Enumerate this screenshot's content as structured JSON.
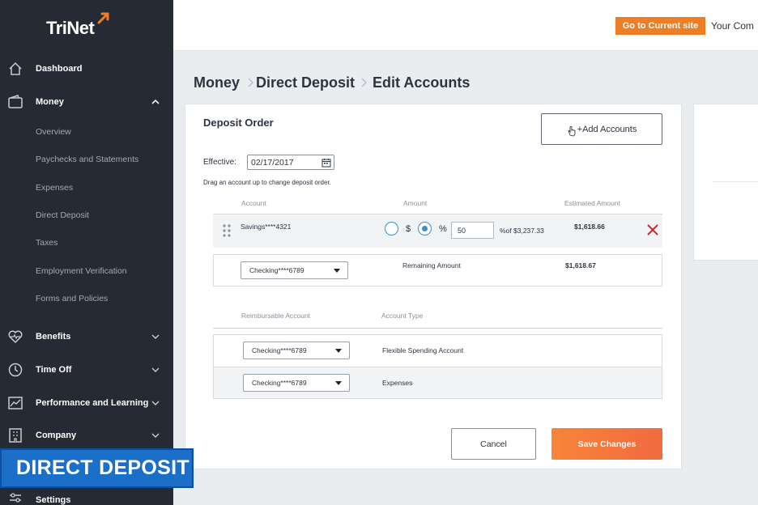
{
  "brand": {
    "logo": "TriNet"
  },
  "topbar": {
    "goto_label": "Go to Current site",
    "company_label": "Your Com"
  },
  "sidebar": {
    "items": [
      {
        "label": "Dashboard",
        "icon": "home-icon"
      },
      {
        "label": "Money",
        "icon": "wallet-icon",
        "expanded": true
      },
      {
        "label": "Benefits",
        "icon": "heart-pulse-icon"
      },
      {
        "label": "Time Off",
        "icon": "clock-icon"
      },
      {
        "label": "Performance and Learning",
        "icon": "chart-icon"
      },
      {
        "label": "Company",
        "icon": "company-icon"
      },
      {
        "label": "Settings",
        "icon": "settings-icon"
      }
    ],
    "money_sub": [
      "Overview",
      "Paychecks and Statements",
      "Expenses",
      "Direct Deposit",
      "Taxes",
      "Employment Verification",
      "Forms and Policies"
    ]
  },
  "breadcrumb": [
    "Money",
    "Direct Deposit",
    "Edit Accounts"
  ],
  "deposit": {
    "title": "Deposit Order",
    "add_accounts": "+Add Accounts",
    "effective_label": "Effective:",
    "effective_date": "02/17/2017",
    "drag_hint": "Drag an account up to change deposit order.",
    "headers": {
      "account": "Account",
      "amount": "Amount",
      "estimated": "Estimated Amount"
    },
    "savings": {
      "account": "Savings****4321",
      "dollar": "$",
      "percent": "%",
      "value": "50",
      "of_total": "%of $3,237.33",
      "estimated": "$1,618.66",
      "selected_mode": "percent"
    },
    "checking": {
      "account": "Checking****6789",
      "amount_label": "Remaining Amount",
      "estimated": "$1,618.67"
    }
  },
  "reimbursable": {
    "headers": {
      "account": "Reimbursable Account",
      "type": "Account Type"
    },
    "rows": [
      {
        "account": "Checking****6789",
        "type": "Flexible Spending Account"
      },
      {
        "account": "Checking****6789",
        "type": "Expenses"
      }
    ]
  },
  "actions": {
    "cancel": "Cancel",
    "save": "Save Changes"
  },
  "overlay": {
    "banner": "DIRECT DEPOSIT"
  },
  "colors": {
    "accent_orange": "#ee7d25",
    "sidebar_bg": "#252a34",
    "radio_blue": "#3a8fc7",
    "remove_red": "#d0283b",
    "banner_blue": "#1b6fc9"
  }
}
